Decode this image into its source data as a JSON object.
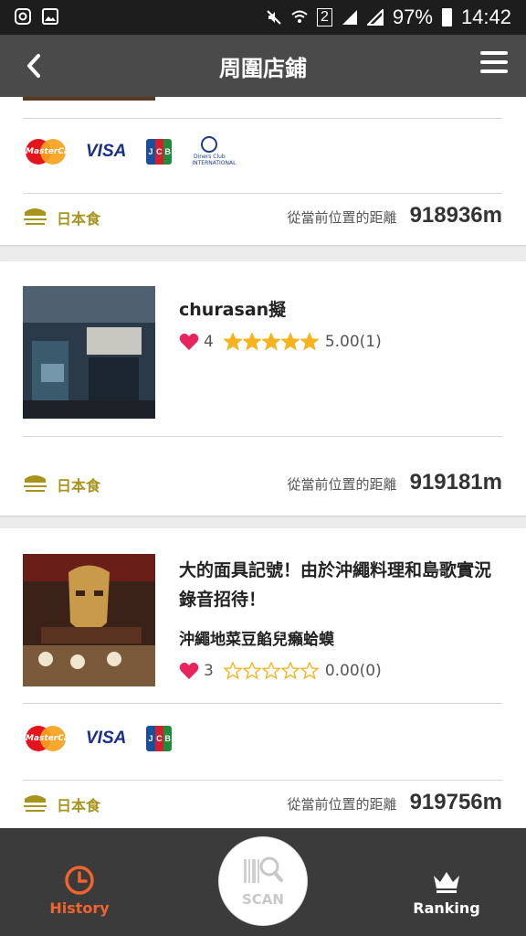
{
  "status_bar": {
    "sim": "2",
    "battery": "97%",
    "time": "14:42"
  },
  "header": {
    "title": "周圍店鋪"
  },
  "distance_label": "從當前位置的距離",
  "cards": [
    {
      "payments": [
        "MasterCard",
        "VISA",
        "JCB",
        "Diners Club INTERNATIONAL"
      ],
      "category": "日本食",
      "distance": "918936m"
    },
    {
      "name": "churasan擬",
      "favorites": "4",
      "rating_stars": 5,
      "score": "5.00(1)",
      "category": "日本食",
      "distance": "919181m"
    },
    {
      "name": "大的面具記號！由於沖繩料理和島歌實況錄音招待！",
      "subname": "沖繩地菜豆餡兒癩蛤蟆",
      "favorites": "3",
      "rating_stars": 0,
      "score": "0.00(0)",
      "payments": [
        "MasterCard",
        "VISA",
        "JCB"
      ],
      "category": "日本食",
      "distance": "919756m"
    }
  ],
  "bottom_nav": {
    "history": "History",
    "scan": "SCAN",
    "ranking": "Ranking"
  },
  "colors": {
    "accent_history": "#f0642d",
    "category_gold": "#a7941d",
    "heart": "#e8245e",
    "star": "#f5b41e"
  }
}
